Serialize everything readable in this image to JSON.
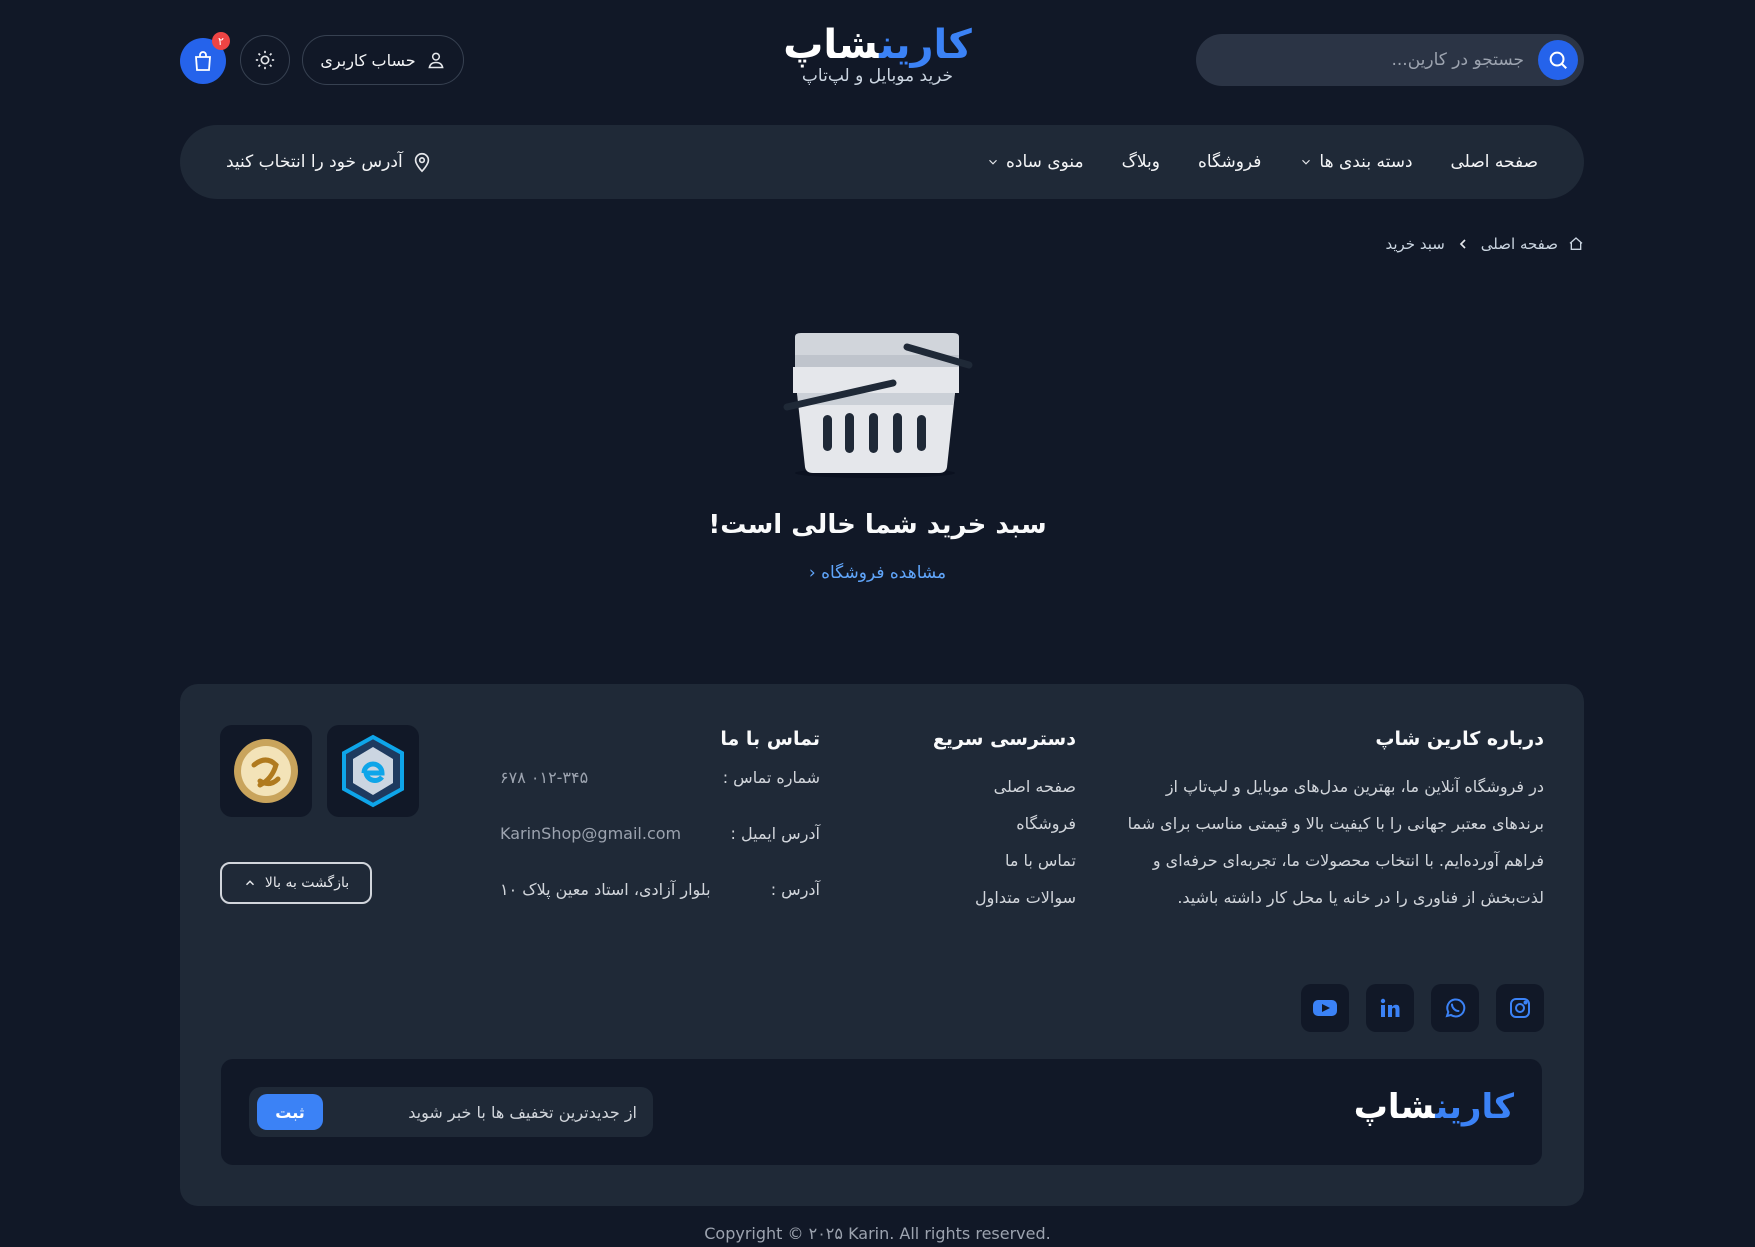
{
  "header": {
    "search_placeholder": "جستجو در کارین...",
    "logo_blue": "کارین",
    "logo_white": "شاپ",
    "logo_subtitle": "خرید موبایل و لپ‌تاپ",
    "account_label": "حساب کاربری",
    "cart_count": "۲"
  },
  "nav": {
    "items": [
      {
        "label": "صفحه اصلی"
      },
      {
        "label": "دسته بندی ها"
      },
      {
        "label": "فروشگاه"
      },
      {
        "label": "وبلاگ"
      },
      {
        "label": "منوی ساده"
      }
    ],
    "address_label": "آدرس خود را انتخاب کنید"
  },
  "breadcrumb": {
    "home": "صفحه اصلی",
    "current": "سبد خرید"
  },
  "empty_cart": {
    "title": "سبد خرید شما خالی است!",
    "link": "مشاهده فروشگاه"
  },
  "footer": {
    "about": {
      "heading": "درباره کارین شاپ",
      "text": "در فروشگاه آنلاین ما، بهترین مدل‌های موبایل و لپ‌تاپ از برندهای معتبر جهانی را با کیفیت بالا و قیمتی مناسب برای شما فراهم آورده‌ایم. با انتخاب محصولات ما، تجربه‌ای حرفه‌ای و لذت‌بخش از فناوری را در خانه یا محل کار داشته باشید."
    },
    "quick": {
      "heading": "دسترسی سریع",
      "links": [
        "صفحه اصلی",
        "فروشگاه",
        "تماس با ما",
        "سوالات متداول"
      ]
    },
    "contact": {
      "heading": "تماس با ما",
      "phone_label": "شماره تماس :",
      "phone": "۰۱۲-۳۴۵ ۶۷۸",
      "email_label": "آدرس ایمیل :",
      "email": "KarinShop@gmail.com",
      "address_label": "آدرس :",
      "address": "بلوار آزادی، استاد معین پلاک ۱۰"
    },
    "back_to_top": "بازگشت به بالا",
    "socials": [
      "instagram-icon",
      "whatsapp-icon",
      "linkedin-icon",
      "youtube-icon"
    ],
    "newsletter": {
      "logo_blue": "کارین",
      "logo_white": "شاپ",
      "placeholder": "از جدیدترین تخفیف ها با خبر شوید",
      "submit": "ثبت"
    },
    "copyright": "Copyright © ۲۰۲۵ Karin. All rights reserved."
  },
  "colors": {
    "background": "#111827",
    "surface": "#1f2937",
    "accent": "#2563eb",
    "link": "#60a5fa",
    "badge": "#ef4444"
  }
}
